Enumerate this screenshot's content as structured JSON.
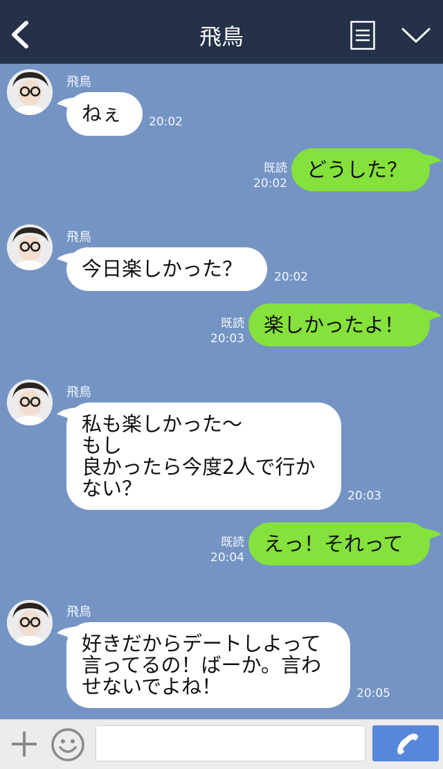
{
  "header": {
    "title": "飛鳥",
    "back_icon": "chevron-left-icon",
    "menu_icon": "menu-list-icon",
    "collapse_icon": "chevron-down-icon",
    "background": "#243149"
  },
  "messages": [
    {
      "side": "left",
      "sender": "飛鳥",
      "text": "ねぇ",
      "time": "20:02"
    },
    {
      "side": "right",
      "text": "どうした？",
      "read": "既読",
      "time": "20:02"
    },
    {
      "side": "left",
      "sender": "飛鳥",
      "text": "今日楽しかった？",
      "time": "20:02"
    },
    {
      "side": "right",
      "text": "楽しかったよ！",
      "read": "既読",
      "time": "20:03"
    },
    {
      "side": "left",
      "sender": "飛鳥",
      "text": "私も楽しかった〜\nもし\n良かったら今度2人で行か\nない？",
      "time": "20:03"
    },
    {
      "side": "right",
      "text": "えっ！それって",
      "read": "既読",
      "time": "20:04"
    },
    {
      "side": "left",
      "sender": "飛鳥",
      "text": "好きだからデートしよって\n言ってるの！ばーか。言わ\nせないでよね！",
      "time": "20:05"
    }
  ],
  "input_bar": {
    "plus_icon": "plus-icon",
    "emoji_icon": "smiley-icon",
    "placeholder": "",
    "call_icon": "phone-icon"
  },
  "colors": {
    "chat_background": "#7494c4",
    "bubble_left": "#ffffff",
    "bubble_right": "#85e13b",
    "call_button": "#5687d9"
  }
}
